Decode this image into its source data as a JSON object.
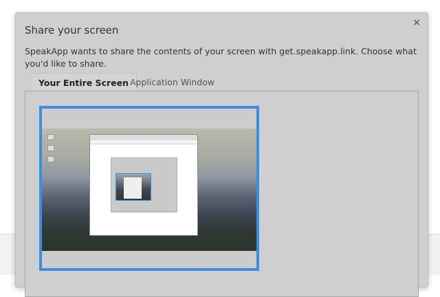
{
  "dialog": {
    "title": "Share your screen",
    "close_icon": "×",
    "description": "SpeakApp wants to share the contents of your screen with get.speakapp.link. Choose what you'd like to share.",
    "tabs": [
      {
        "label": "Your Entire Screen",
        "active": true
      },
      {
        "label": "Application Window",
        "active": false
      }
    ],
    "accent_color": "#3a8ee6"
  }
}
